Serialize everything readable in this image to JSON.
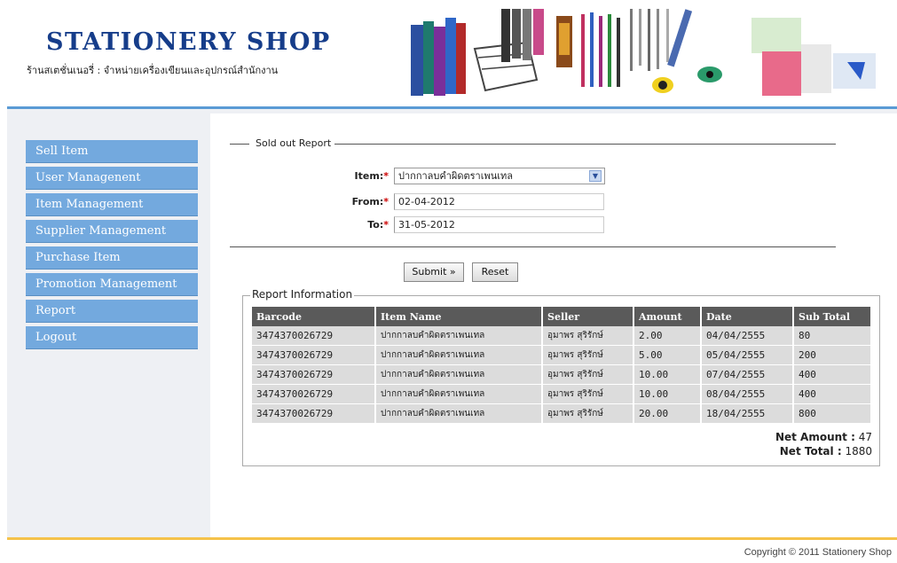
{
  "header": {
    "logo": "STATIONERY SHOP",
    "tagline": "ร้านสเตชั่นเนอรี่ : จำหน่ายเครื่องเขียนและอุปกรณ์สำนักงาน"
  },
  "sidebar": {
    "items": [
      {
        "label": "Sell Item"
      },
      {
        "label": "User Managenent"
      },
      {
        "label": "Item Management"
      },
      {
        "label": "Supplier Management"
      },
      {
        "label": "Purchase Item"
      },
      {
        "label": "Promotion Management"
      },
      {
        "label": "Report"
      },
      {
        "label": "Logout"
      }
    ]
  },
  "form": {
    "legend": "Sold out Report",
    "item_label": "Item:",
    "item_value": "ปากกาลบคำผิดตราเพนเทล",
    "from_label": "From:",
    "from_value": "02-04-2012",
    "to_label": "To:",
    "to_value": "31-05-2012",
    "required_mark": "*",
    "submit_label": "Submit »",
    "reset_label": "Reset"
  },
  "report": {
    "legend": "Report Information",
    "columns": [
      "Barcode",
      "Item Name",
      "Seller",
      "Amount",
      "Date",
      "Sub Total"
    ],
    "rows": [
      [
        "3474370026729",
        "ปากกาลบคำผิดตราเพนเทล",
        "อุมาพร สุริรักษ์",
        "2.00",
        "04/04/2555",
        "80"
      ],
      [
        "3474370026729",
        "ปากกาลบคำผิดตราเพนเทล",
        "อุมาพร สุริรักษ์",
        "5.00",
        "05/04/2555",
        "200"
      ],
      [
        "3474370026729",
        "ปากกาลบคำผิดตราเพนเทล",
        "อุมาพร สุริรักษ์",
        "10.00",
        "07/04/2555",
        "400"
      ],
      [
        "3474370026729",
        "ปากกาลบคำผิดตราเพนเทล",
        "อุมาพร สุริรักษ์",
        "10.00",
        "08/04/2555",
        "400"
      ],
      [
        "3474370026729",
        "ปากกาลบคำผิดตราเพนเทล",
        "อุมาพร สุริรักษ์",
        "20.00",
        "18/04/2555",
        "800"
      ]
    ],
    "net_amount_label": "Net Amount :",
    "net_amount_value": "47",
    "net_total_label": "Net Total :",
    "net_total_value": "1880"
  },
  "footer": {
    "copyright": "Copyright © 2011 Stationery Shop"
  },
  "colors": {
    "menu_bg": "#73a9de",
    "logo": "#163d8a",
    "header_th": "#5a5a5a",
    "footer_line": "#f5c24a",
    "top_line": "#5a9bd5"
  }
}
